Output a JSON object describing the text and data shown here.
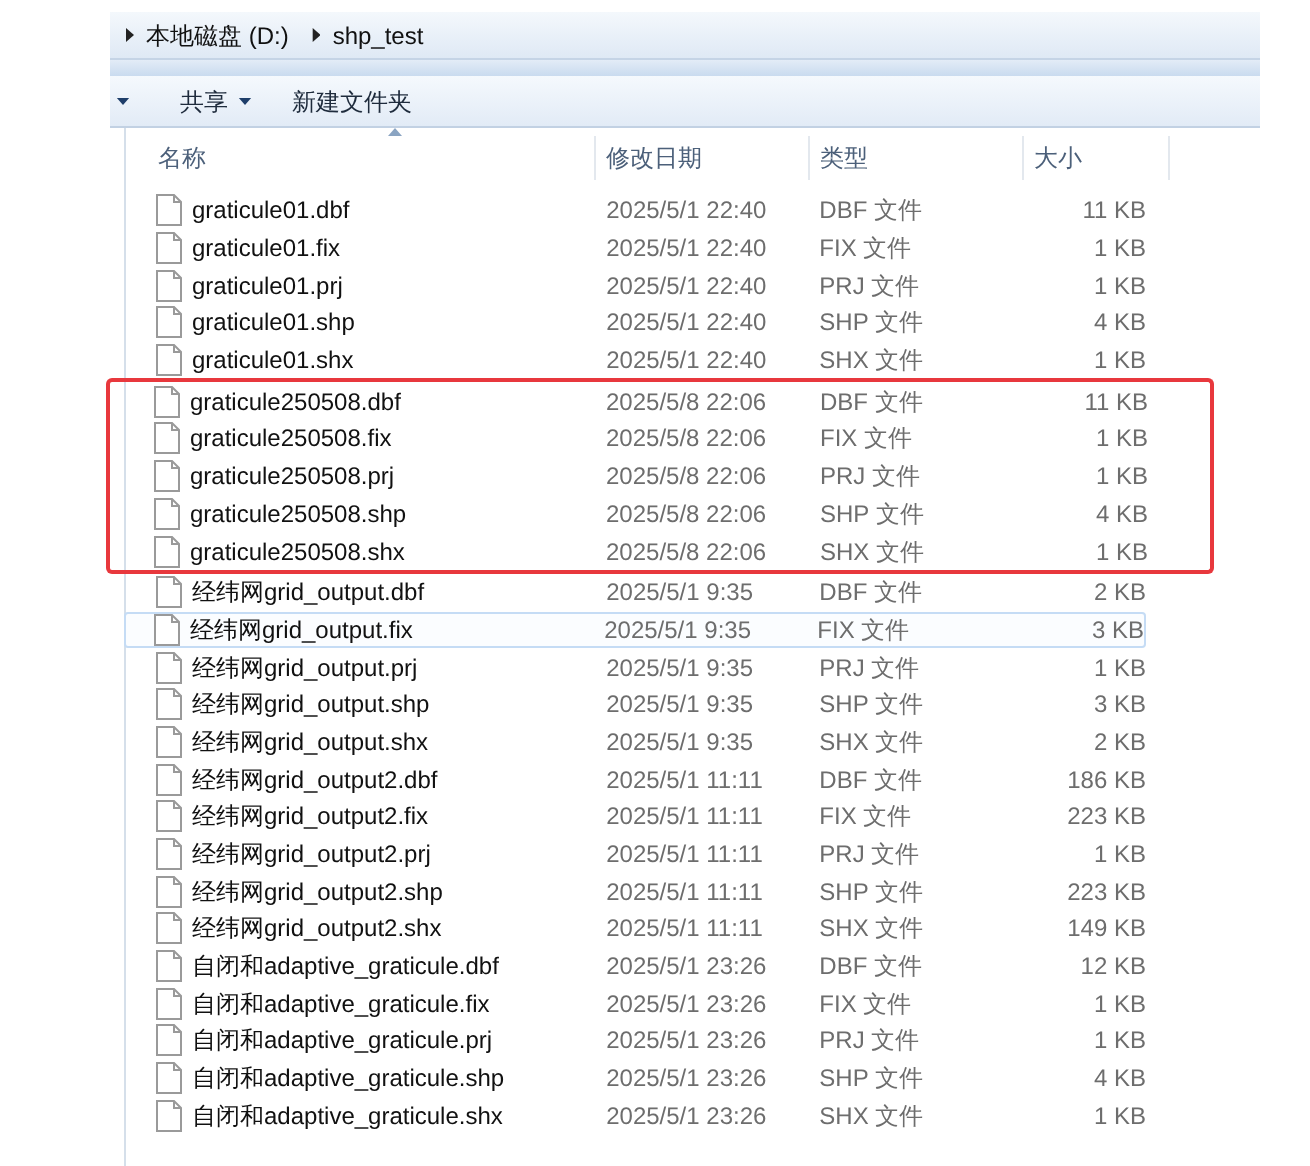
{
  "breadcrumb": [
    "本地磁盘 (D:)",
    "shp_test"
  ],
  "toolbar": {
    "buttons": [
      {
        "label": "共享",
        "dropdown": true
      },
      {
        "label": "新建文件夹",
        "dropdown": false
      }
    ]
  },
  "table": {
    "columns": [
      "名称",
      "修改日期",
      "类型",
      "大小"
    ],
    "rows": [
      {
        "name": "graticule01.dbf",
        "date": "2025/5/1 22:40",
        "type": "DBF 文件",
        "size": "11 KB",
        "highlighted": false,
        "hovered": false
      },
      {
        "name": "graticule01.fix",
        "date": "2025/5/1 22:40",
        "type": "FIX 文件",
        "size": "1 KB",
        "highlighted": false,
        "hovered": false
      },
      {
        "name": "graticule01.prj",
        "date": "2025/5/1 22:40",
        "type": "PRJ 文件",
        "size": "1 KB",
        "highlighted": false,
        "hovered": false
      },
      {
        "name": "graticule01.shp",
        "date": "2025/5/1 22:40",
        "type": "SHP 文件",
        "size": "4 KB",
        "highlighted": false,
        "hovered": false
      },
      {
        "name": "graticule01.shx",
        "date": "2025/5/1 22:40",
        "type": "SHX 文件",
        "size": "1 KB",
        "highlighted": false,
        "hovered": false
      },
      {
        "name": "graticule250508.dbf",
        "date": "2025/5/8 22:06",
        "type": "DBF 文件",
        "size": "11 KB",
        "highlighted": true,
        "hovered": false
      },
      {
        "name": "graticule250508.fix",
        "date": "2025/5/8 22:06",
        "type": "FIX 文件",
        "size": "1 KB",
        "highlighted": true,
        "hovered": false
      },
      {
        "name": "graticule250508.prj",
        "date": "2025/5/8 22:06",
        "type": "PRJ 文件",
        "size": "1 KB",
        "highlighted": true,
        "hovered": false
      },
      {
        "name": "graticule250508.shp",
        "date": "2025/5/8 22:06",
        "type": "SHP 文件",
        "size": "4 KB",
        "highlighted": true,
        "hovered": false
      },
      {
        "name": "graticule250508.shx",
        "date": "2025/5/8 22:06",
        "type": "SHX 文件",
        "size": "1 KB",
        "highlighted": true,
        "hovered": false
      },
      {
        "name": "经纬网grid_output.dbf",
        "date": "2025/5/1 9:35",
        "type": "DBF 文件",
        "size": "2 KB",
        "highlighted": false,
        "hovered": false
      },
      {
        "name": "经纬网grid_output.fix",
        "date": "2025/5/1 9:35",
        "type": "FIX 文件",
        "size": "3 KB",
        "highlighted": false,
        "hovered": true
      },
      {
        "name": "经纬网grid_output.prj",
        "date": "2025/5/1 9:35",
        "type": "PRJ 文件",
        "size": "1 KB",
        "highlighted": false,
        "hovered": false
      },
      {
        "name": "经纬网grid_output.shp",
        "date": "2025/5/1 9:35",
        "type": "SHP 文件",
        "size": "3 KB",
        "highlighted": false,
        "hovered": false
      },
      {
        "name": "经纬网grid_output.shx",
        "date": "2025/5/1 9:35",
        "type": "SHX 文件",
        "size": "2 KB",
        "highlighted": false,
        "hovered": false
      },
      {
        "name": "经纬网grid_output2.dbf",
        "date": "2025/5/1 11:11",
        "type": "DBF 文件",
        "size": "186 KB",
        "highlighted": false,
        "hovered": false
      },
      {
        "name": "经纬网grid_output2.fix",
        "date": "2025/5/1 11:11",
        "type": "FIX 文件",
        "size": "223 KB",
        "highlighted": false,
        "hovered": false
      },
      {
        "name": "经纬网grid_output2.prj",
        "date": "2025/5/1 11:11",
        "type": "PRJ 文件",
        "size": "1 KB",
        "highlighted": false,
        "hovered": false
      },
      {
        "name": "经纬网grid_output2.shp",
        "date": "2025/5/1 11:11",
        "type": "SHP 文件",
        "size": "223 KB",
        "highlighted": false,
        "hovered": false
      },
      {
        "name": "经纬网grid_output2.shx",
        "date": "2025/5/1 11:11",
        "type": "SHX 文件",
        "size": "149 KB",
        "highlighted": false,
        "hovered": false
      },
      {
        "name": "自闭和adaptive_graticule.dbf",
        "date": "2025/5/1 23:26",
        "type": "DBF 文件",
        "size": "12 KB",
        "highlighted": false,
        "hovered": false
      },
      {
        "name": "自闭和adaptive_graticule.fix",
        "date": "2025/5/1 23:26",
        "type": "FIX 文件",
        "size": "1 KB",
        "highlighted": false,
        "hovered": false
      },
      {
        "name": "自闭和adaptive_graticule.prj",
        "date": "2025/5/1 23:26",
        "type": "PRJ 文件",
        "size": "1 KB",
        "highlighted": false,
        "hovered": false
      },
      {
        "name": "自闭和adaptive_graticule.shp",
        "date": "2025/5/1 23:26",
        "type": "SHP 文件",
        "size": "4 KB",
        "highlighted": false,
        "hovered": false
      },
      {
        "name": "自闭和adaptive_graticule.shx",
        "date": "2025/5/1 23:26",
        "type": "SHX 文件",
        "size": "1 KB",
        "highlighted": false,
        "hovered": false
      }
    ]
  }
}
